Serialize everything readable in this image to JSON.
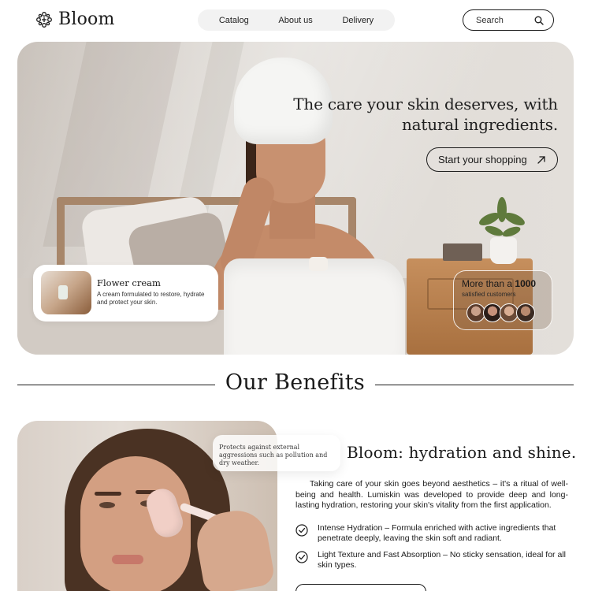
{
  "brand": {
    "name": "Bloom"
  },
  "nav": {
    "items": [
      "Catalog",
      "About us",
      "Delivery"
    ]
  },
  "search": {
    "placeholder": "Search",
    "icon": "search-icon"
  },
  "hero": {
    "title": "The care your skin deserves, with natural ingredients.",
    "cta_label": "Start your shopping",
    "cta_icon": "arrow-up-right-icon",
    "product": {
      "name": "Flower cream",
      "description": "A cream formulated to restore, hydrate and protect your skin."
    },
    "customers": {
      "prefix": "More than a",
      "count": "1000",
      "label": "satisfied customers"
    }
  },
  "benefits": {
    "heading": "Our Benefits",
    "tooltip": "Protects against external aggressions such as pollution and dry weather.",
    "title": "Bloom: hydration and shine.",
    "body": "Taking care of your skin goes beyond aesthetics – it's a ritual of well-being and health. Lumiskin was developed to provide deep and long-lasting hydration, restoring your skin's vitality from the first application.",
    "features": [
      "Intense Hydration – Formula enriched with active ingredients that penetrate deeply, leaving the skin soft and radiant.",
      "Light Texture and Fast Absorption – No sticky sensation, ideal for all skin types."
    ]
  },
  "colors": {
    "text": "#1a1a1a",
    "nav_bg": "#f2f2f2",
    "background": "#ffffff"
  }
}
